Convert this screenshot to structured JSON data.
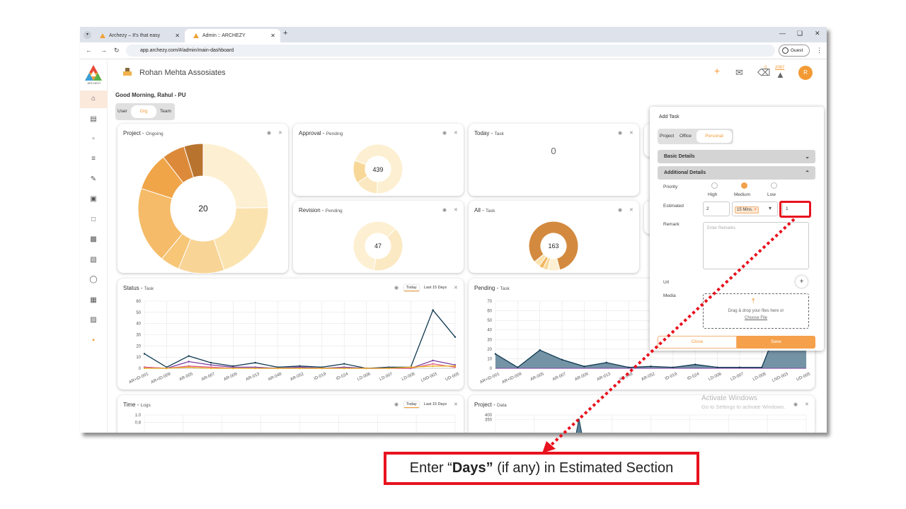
{
  "browser": {
    "tabs": [
      {
        "label": "Archezy – It's that easy",
        "active": false
      },
      {
        "label": "Admin :: ARCHEZY",
        "active": true
      }
    ],
    "url": "app.archezy.com/#/admin/main-dashboard",
    "profile_label": "Guest"
  },
  "header": {
    "org_name": "Rohan Mehta Assosiates",
    "chat_badge": "0",
    "bell_badge": "2067",
    "avatar_initial": "R",
    "logo_text": "ARCHEZY"
  },
  "greeting": "Good Morning, Rahul - PU",
  "view_toggle": {
    "options": [
      "User",
      "Org",
      "Team"
    ],
    "selected": "Org"
  },
  "cards": {
    "project": {
      "title": "Project",
      "subtitle": "Ongoing",
      "center": "20"
    },
    "approval": {
      "title": "Approval",
      "subtitle": "Pending",
      "center": "439"
    },
    "today": {
      "title": "Today",
      "subtitle": "Task",
      "value": "0"
    },
    "revision": {
      "title": "Revision",
      "subtitle": "Pending",
      "center": "47"
    },
    "all": {
      "title": "All",
      "subtitle": "Task",
      "center": "163"
    },
    "status": {
      "title": "Status",
      "subtitle": "Task",
      "filter_today": "Today",
      "filter_15": "Last 15 Days"
    },
    "pending": {
      "title": "Pending",
      "subtitle": "Task"
    },
    "time": {
      "title": "Time",
      "subtitle": "Logs",
      "filter_today": "Today",
      "filter_15": "Last 15 Days"
    },
    "project_data": {
      "title": "Project",
      "subtitle": "Data"
    }
  },
  "chart_data": [
    {
      "type": "pie",
      "name_ref": "project-ongoing",
      "center_label": "20",
      "values": [
        26,
        21,
        12,
        5,
        20,
        10,
        6,
        5
      ],
      "colors": [
        "#fdf0d2",
        "#fbe3b0",
        "#f8d496",
        "#f7c677",
        "#f5bb68",
        "#f0a548",
        "#dc8a3a",
        "#b8742f"
      ]
    },
    {
      "type": "pie",
      "name_ref": "approval-pending",
      "center_label": "439",
      "values": [
        70,
        15,
        15
      ],
      "colors": [
        "#fdf0d2",
        "#fbe8c0",
        "#f8d899"
      ]
    },
    {
      "type": "pie",
      "name_ref": "revision-pending",
      "center_label": "47",
      "values": [
        60,
        40
      ],
      "colors": [
        "#fdf0d2",
        "#fbe9c3"
      ]
    },
    {
      "type": "pie",
      "name_ref": "all-task",
      "center_label": "163",
      "values": [
        82,
        8,
        3,
        3,
        4
      ],
      "colors": [
        "#d38a3f",
        "#fdf0d2",
        "#f8d899",
        "#f2b763",
        "#fbe3b0"
      ]
    },
    {
      "type": "line",
      "name_ref": "status-task",
      "categories": [
        "AR+ID-001",
        "AR+ID-009",
        "AR-005",
        "AR-007",
        "AR-009",
        "AR-013",
        "AR-048",
        "AR-052",
        "ID-019",
        "ID-024",
        "LD-006",
        "LD-007",
        "LD-008",
        "LND-003",
        "UD-005"
      ],
      "ylim": [
        0,
        60
      ],
      "yticks": [
        0,
        10,
        20,
        30,
        40,
        50,
        60
      ],
      "series": [
        {
          "values": [
            13,
            1,
            11,
            5,
            2,
            5,
            1,
            2,
            1,
            4,
            0,
            1,
            1,
            52,
            28
          ],
          "color": "#0f3850"
        },
        {
          "values": [
            1,
            0,
            6,
            3,
            1,
            1,
            0,
            1,
            0,
            1,
            0,
            0,
            0,
            7,
            3
          ],
          "color": "#7b3fa0"
        },
        {
          "values": [
            1,
            0,
            2,
            1,
            0,
            0,
            0,
            0,
            0,
            0,
            0,
            0,
            0,
            4,
            1
          ],
          "color": "#e05a8a"
        },
        {
          "values": [
            0,
            0,
            1,
            0,
            0,
            0,
            0,
            0,
            0,
            0,
            0,
            0,
            1,
            2,
            2
          ],
          "color": "#e8b020"
        }
      ]
    },
    {
      "type": "area",
      "name_ref": "pending-task",
      "categories": [
        "AR+ID-001",
        "AR+ID-009",
        "AR-005",
        "AR-007",
        "AR-009",
        "AR-013",
        "AR-048",
        "AR-052",
        "ID-019",
        "ID-024",
        "LD-006",
        "LD-007",
        "LD-008",
        "LND-003",
        "UD-005"
      ],
      "ylim": [
        0,
        70
      ],
      "yticks": [
        0,
        10,
        20,
        30,
        40,
        50,
        60,
        70
      ],
      "series": [
        {
          "values": [
            15,
            1,
            19,
            9,
            2,
            6,
            1,
            2,
            1,
            4,
            1,
            1,
            1,
            60,
            60
          ],
          "color": "#5c8196"
        }
      ]
    },
    {
      "type": "line",
      "name_ref": "time-logs",
      "ylim": [
        0,
        1.0
      ],
      "yticks": [
        0.8,
        1.0
      ],
      "series": []
    },
    {
      "type": "line",
      "name_ref": "project-data",
      "ylim": [
        0,
        400
      ],
      "yticks": [
        350,
        400
      ],
      "series": []
    }
  ],
  "add_task": {
    "title": "Add Task",
    "type_options": [
      "Project",
      "Office",
      "Personal"
    ],
    "type_selected": "Personal",
    "basic_details": "Basic Details",
    "additional_details": "Additional Details",
    "priority_label": "Priority",
    "priority_options": [
      "High",
      "Medium",
      "Low"
    ],
    "priority_selected": "Medium",
    "estimated_label": "Estimated",
    "estimated_hours": "2",
    "estimated_chip": "15 Mins.",
    "estimated_days": "1",
    "remark_label": "Remark",
    "remark_placeholder": "Enter Remarks",
    "url_label": "Url",
    "media_label": "Media",
    "drop_text": "Drag & drop your files here or",
    "choose_file": "Choose File",
    "close_label": "Close",
    "save_label": "Save"
  },
  "watermark": {
    "line1": "Activate Windows",
    "line2": "Go to Settings to activate Windows."
  },
  "callout": {
    "prefix": "Enter “",
    "bold": "Days”",
    "suffix": " (if any) in Estimated Section"
  },
  "accent_color": "#f39a35",
  "highlight_color": "#e8121e"
}
